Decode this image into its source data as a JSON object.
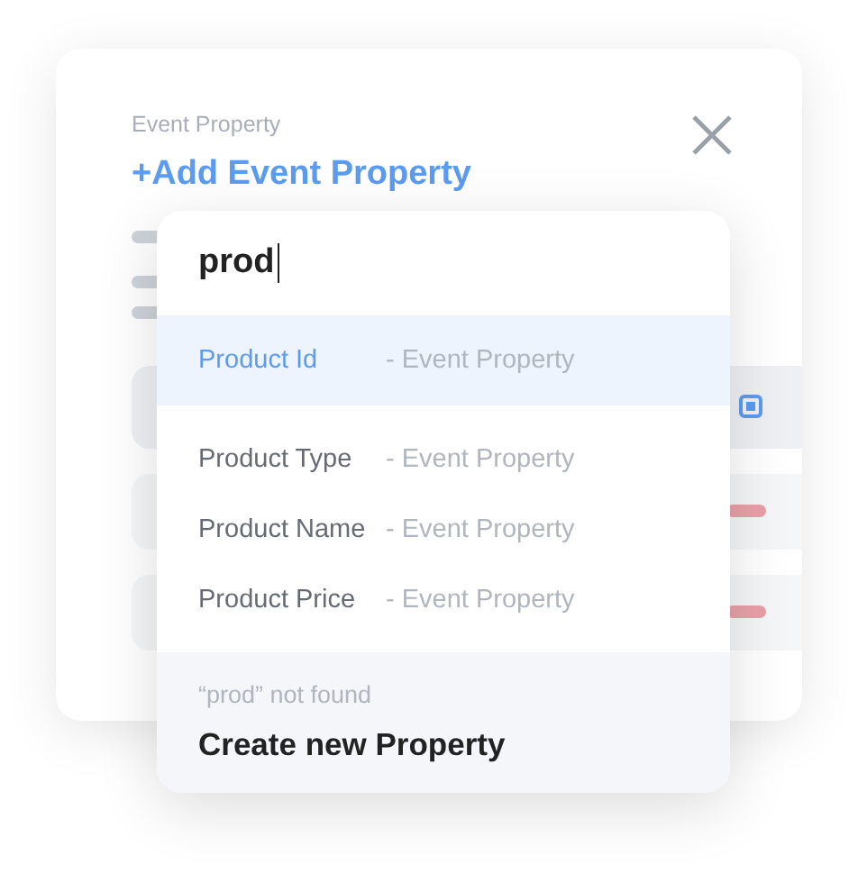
{
  "card": {
    "label": "Event Property",
    "add_link": "+Add Event Property",
    "rows": [
      {
        "kind": "checkbox",
        "checked": true
      },
      {
        "kind": "tag"
      },
      {
        "kind": "tag"
      }
    ]
  },
  "dropdown": {
    "search": {
      "value": "prod"
    },
    "options": [
      {
        "name": "Product Id",
        "type": "- Event Property",
        "selected": true
      },
      {
        "name": "Product Type",
        "type": "- Event Property",
        "selected": false
      },
      {
        "name": "Product Name",
        "type": "- Event Property",
        "selected": false
      },
      {
        "name": "Product Price",
        "type": "- Event Property",
        "selected": false
      }
    ],
    "footer": {
      "message": "“prod” not found",
      "action": "Create new Property"
    }
  }
}
